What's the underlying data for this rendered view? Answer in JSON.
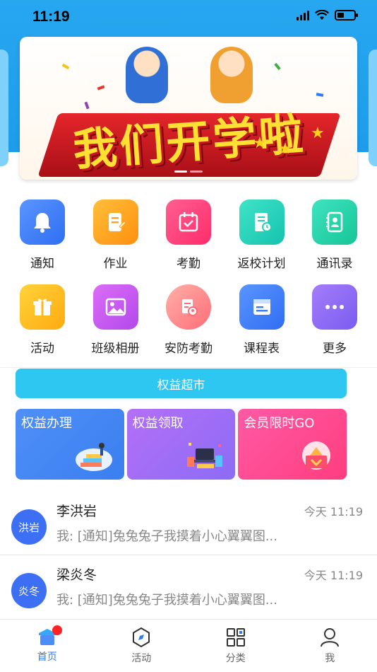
{
  "status_bar": {
    "time": "11:19"
  },
  "banner": {
    "headline": "我们开学啦"
  },
  "grid": [
    {
      "label": "通知",
      "icon": "bell-icon",
      "color": "#3d7ff6"
    },
    {
      "label": "作业",
      "icon": "homework-icon",
      "color": "#ffa51c"
    },
    {
      "label": "考勤",
      "icon": "calendar-check-icon",
      "color": "#ff3d78"
    },
    {
      "label": "返校计划",
      "icon": "receipt-clock-icon",
      "color": "#22d1b8"
    },
    {
      "label": "通讯录",
      "icon": "contacts-icon",
      "color": "#26cfa7"
    },
    {
      "label": "活动",
      "icon": "gift-icon",
      "color": "#ffb81c"
    },
    {
      "label": "班级相册",
      "icon": "photo-icon",
      "color": "#c85cf0"
    },
    {
      "label": "安防考勤",
      "icon": "security-checkin-icon",
      "color": "#ff6d78"
    },
    {
      "label": "课程表",
      "icon": "schedule-icon",
      "color": "#3f7ef5"
    },
    {
      "label": "更多",
      "icon": "more-icon",
      "color": "#8f6bf2"
    }
  ],
  "benefits": {
    "market_label": "权益超市",
    "cards": [
      {
        "title": "权益办理"
      },
      {
        "title": "权益领取"
      },
      {
        "title": "会员限时GO"
      }
    ]
  },
  "messages": [
    {
      "avatar": "洪岩",
      "name": "李洪岩",
      "time": "今天 11:19",
      "preview": "我: [通知]兔兔兔子我摸着小心翼翼图..."
    },
    {
      "avatar": "炎冬",
      "name": "梁炎冬",
      "time": "今天 11:19",
      "preview": "我: [通知]兔兔兔子我摸着小心翼翼图..."
    }
  ],
  "tabbar": [
    {
      "label": "首页",
      "icon": "home-icon"
    },
    {
      "label": "活动",
      "icon": "compass-icon"
    },
    {
      "label": "分类",
      "icon": "category-icon"
    },
    {
      "label": "我",
      "icon": "profile-icon"
    }
  ],
  "colors": {
    "accent": "#2f7bf5",
    "header": "#27a7f0",
    "market": "#2dc7f2",
    "badge": "#ff2222"
  }
}
